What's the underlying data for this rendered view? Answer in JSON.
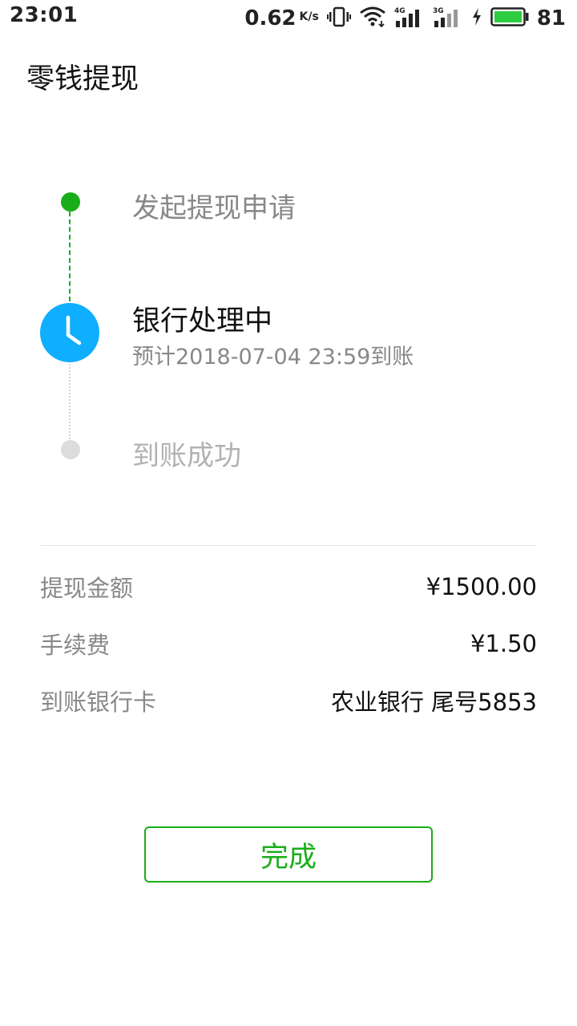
{
  "status_bar": {
    "time": "23:01",
    "net_speed": "0.62",
    "net_speed_unit": "K/s",
    "signal1_label": "4G",
    "signal2_label": "3G",
    "battery_level": "81"
  },
  "page": {
    "title": "零钱提现"
  },
  "progress": {
    "steps": [
      {
        "label": "发起提现申请",
        "state": "done"
      },
      {
        "label": "银行处理中",
        "sub": "预计2018-07-04 23:59到账",
        "state": "current"
      },
      {
        "label": "到账成功",
        "state": "pending"
      }
    ]
  },
  "details": [
    {
      "label": "提现金额",
      "value": "¥1500.00"
    },
    {
      "label": "手续费",
      "value": "¥1.50"
    },
    {
      "label": "到账银行卡",
      "value": "农业银行 尾号5853"
    }
  ],
  "actions": {
    "done_label": "完成"
  },
  "colors": {
    "accent_green": "#1aad19",
    "clock_blue": "#10aeff",
    "text_gray": "#888888",
    "pending_gray": "#dcdcdc"
  },
  "icons": {
    "vibrate": "vibrate-icon",
    "wifi": "wifi-icon",
    "signal": "signal-icon",
    "charging": "charging-icon",
    "battery": "battery-icon",
    "clock": "clock-icon"
  }
}
